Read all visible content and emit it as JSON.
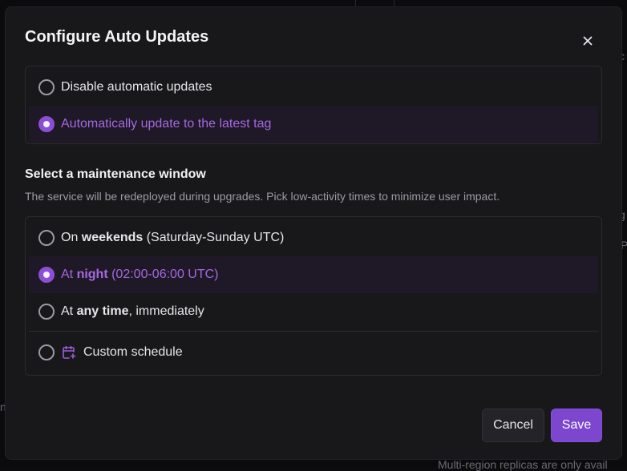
{
  "dialog": {
    "title": "Configure Auto Updates",
    "close_icon": "close-icon"
  },
  "update_mode": {
    "options": [
      {
        "label": "Disable automatic updates",
        "selected": false
      },
      {
        "label": "Automatically update to the latest tag",
        "selected": true
      }
    ]
  },
  "maintenance": {
    "title": "Select a maintenance window",
    "description": "The service will be redeployed during upgrades. Pick low-activity times to minimize user impact.",
    "options": [
      {
        "prefix": "On ",
        "bold": "weekends",
        "suffix": " (Saturday-Sunday UTC)",
        "selected": false
      },
      {
        "prefix": "At ",
        "bold": "night",
        "suffix": " (02:00-06:00 UTC)",
        "selected": true
      },
      {
        "prefix": "At ",
        "bold": "any time",
        "suffix": ", immediately",
        "selected": false
      },
      {
        "label": "Custom schedule",
        "icon": "calendar-plus-icon",
        "selected": false
      }
    ]
  },
  "footer": {
    "cancel_label": "Cancel",
    "save_label": "Save"
  },
  "background": {
    "fragment_1": "c",
    "fragment_2": "g",
    "fragment_3": "P",
    "fragment_4": "n",
    "fragment_5": "Multi-region replicas are only avail"
  },
  "colors": {
    "accent": "#8b4fd6",
    "selected_text": "#a46ae0",
    "dialog_bg": "#18181b"
  }
}
